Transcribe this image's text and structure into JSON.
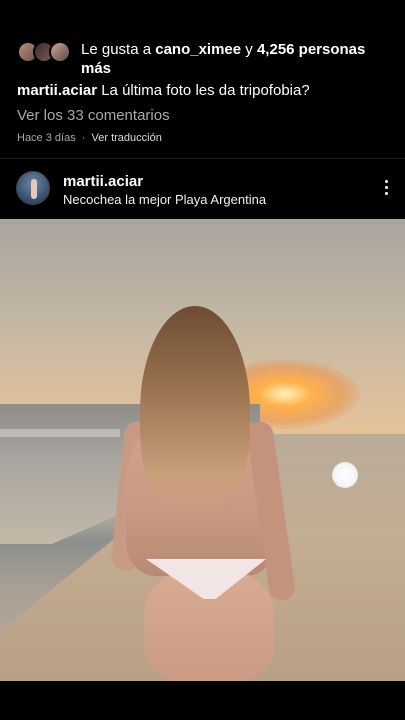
{
  "likes": {
    "prefix": "Le gusta a",
    "user": "cano_ximee",
    "connector": "y",
    "count": "4,256 personas",
    "suffix": "más"
  },
  "caption": {
    "username": "martii.aciar",
    "text": "La última foto les da tripofobia?"
  },
  "comments_link": "Ver los 33 comentarios",
  "meta": {
    "time": "Hace 3 días",
    "separator": "·",
    "translate": "Ver traducción"
  },
  "post": {
    "username": "martii.aciar",
    "location": "Necochea la mejor Playa Argentina"
  },
  "icons": {
    "more": "more-vertical-icon"
  }
}
